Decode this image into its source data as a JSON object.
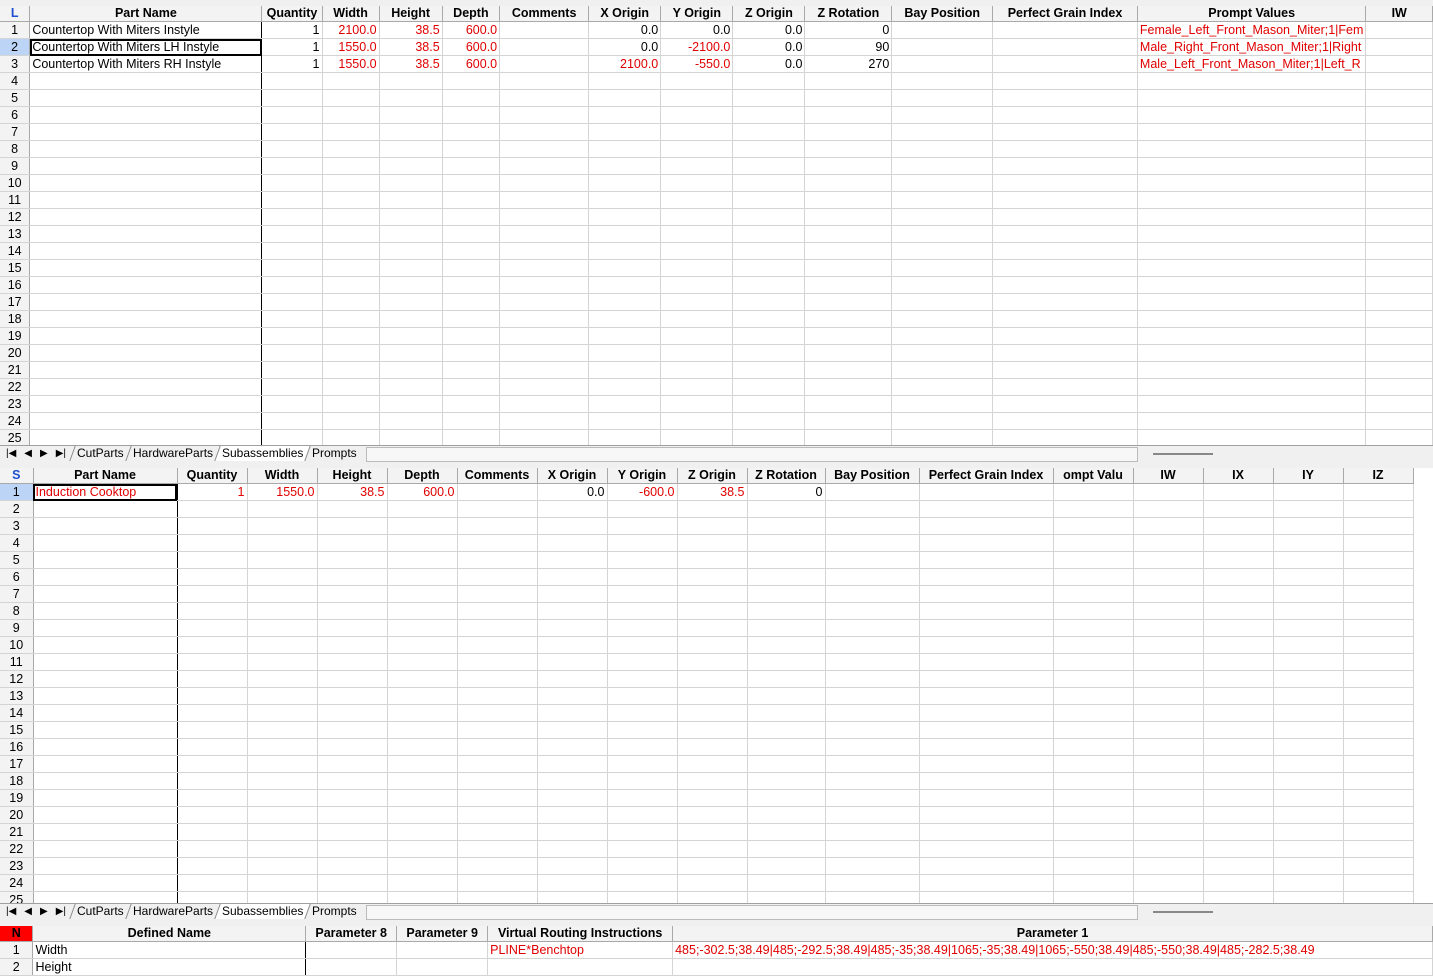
{
  "tabs": [
    "CutParts",
    "HardwareParts",
    "Subassemblies",
    "Prompts"
  ],
  "nav_icons": [
    "first-icon",
    "prev-icon",
    "next-icon",
    "last-icon"
  ],
  "nav_glyphs": [
    "|◀",
    "◀",
    "▶",
    "▶|"
  ],
  "grid1": {
    "corner": "L",
    "headers": [
      "Part Name",
      "Quantity",
      "Width",
      "Height",
      "Depth",
      "Comments",
      "X Origin",
      "Y Origin",
      "Z Origin",
      "Z Rotation",
      "Bay Position",
      "Perfect Grain Index",
      "Prompt Values",
      "IW"
    ],
    "rows": [
      [
        "Countertop With Miters Instyle",
        "1",
        "2100.0",
        "38.5",
        "600.0",
        "",
        "0.0",
        "0.0",
        "0.0",
        "0",
        "",
        "",
        "Female_Left_Front_Mason_Miter;1|Fem",
        ""
      ],
      [
        "Countertop With Miters LH Instyle",
        "1",
        "1550.0",
        "38.5",
        "600.0",
        "",
        "0.0",
        "-2100.0",
        "0.0",
        "90",
        "",
        "",
        "Male_Right_Front_Mason_Miter;1|Right",
        ""
      ],
      [
        "Countertop With Miters RH Instyle",
        "1",
        "1550.0",
        "38.5",
        "600.0",
        "",
        "2100.0",
        "-550.0",
        "0.0",
        "270",
        "",
        "",
        "Male_Left_Front_Mason_Miter;1|Left_R",
        ""
      ]
    ],
    "row_count": 25
  },
  "grid2": {
    "corner": "S",
    "headers": [
      "Part Name",
      "Quantity",
      "Width",
      "Height",
      "Depth",
      "Comments",
      "X Origin",
      "Y Origin",
      "Z Origin",
      "Z Rotation",
      "Bay Position",
      "Perfect Grain Index",
      "ompt Valu",
      "IW",
      "IX",
      "IY",
      "IZ"
    ],
    "rows": [
      [
        "Induction Cooktop",
        "1",
        "1550.0",
        "38.5",
        "600.0",
        "",
        "0.0",
        "-600.0",
        "38.5",
        "0",
        "",
        "",
        "",
        "",
        "",
        "",
        ""
      ]
    ],
    "row_count": 25
  },
  "grid3": {
    "corner": "N",
    "headers": [
      "Defined Name",
      "Parameter 8",
      "Parameter 9",
      "Virtual Routing Instructions",
      "Parameter 1"
    ],
    "rows": [
      [
        "Width",
        "",
        "",
        "PLINE*Benchtop",
        "485;-302.5;38.49|485;-292.5;38.49|485;-35;38.49|1065;-35;38.49|1065;-550;38.49|485;-550;38.49|485;-282.5;38.49"
      ],
      [
        "Height",
        "",
        "",
        "",
        ""
      ]
    ]
  },
  "colors": {
    "red": "#e00000",
    "corner_blue": "#1f4fd0",
    "corner_red_bg": "#ff0000"
  }
}
